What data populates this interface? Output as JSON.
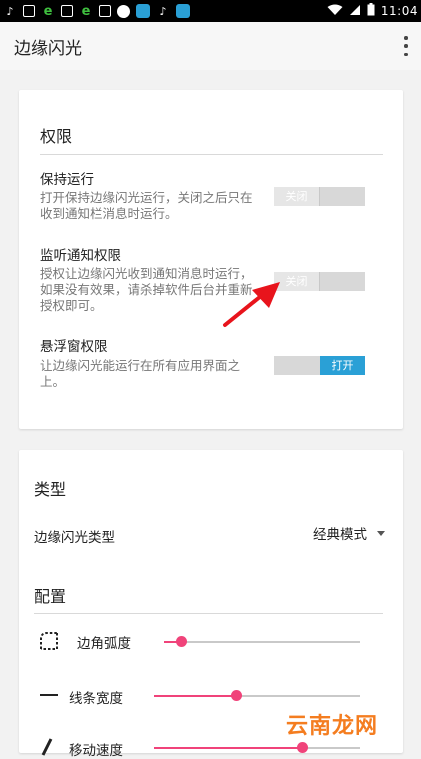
{
  "status_bar": {
    "time": "11:04",
    "battery_icon": "battery-icon",
    "signal_icon": "signal-icon",
    "wifi_icon": "wifi-icon"
  },
  "app_bar": {
    "title": "边缘闪光",
    "menu_icon": "overflow-menu-icon"
  },
  "permissions": {
    "title": "权限",
    "items": [
      {
        "title": "保持运行",
        "desc": "打开保持边缘闪光运行，关闭之后只在收到通知栏消息时运行。",
        "switch_label": "关闭",
        "state": "off"
      },
      {
        "title": "监听通知权限",
        "desc": "授权让边缘闪光收到通知消息时运行，如果没有效果，请杀掉软件后台并重新授权即可。",
        "switch_label": "关闭",
        "state": "off"
      },
      {
        "title": "悬浮窗权限",
        "desc": "让边缘闪光能运行在所有应用界面之上。",
        "switch_label": "打开",
        "state": "on"
      }
    ]
  },
  "type_section": {
    "title": "类型",
    "dropdown_label": "边缘闪光类型",
    "dropdown_value": "经典模式"
  },
  "config_section": {
    "title": "配置",
    "sliders": [
      {
        "label": "边角弧度",
        "icon": "corner-radius-icon",
        "value_fraction": 0.09
      },
      {
        "label": "线条宽度",
        "icon": "line-width-icon",
        "value_fraction": 0.4
      },
      {
        "label": "移动速度",
        "icon": "speed-icon",
        "value_fraction": 0.72
      }
    ]
  },
  "watermark": "云南龙网",
  "colors": {
    "accent_blue": "#2aa0d6",
    "slider_pink": "#f0437a",
    "annotation_red": "#e8141c"
  }
}
